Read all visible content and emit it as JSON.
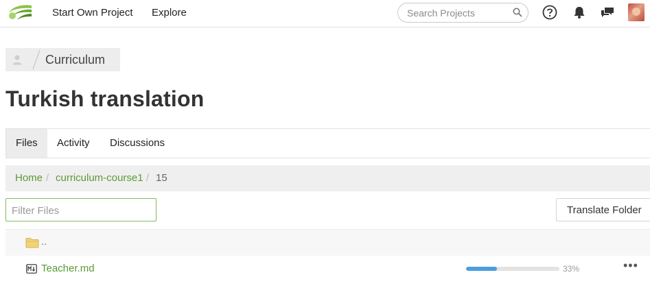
{
  "header": {
    "nav": [
      "Start Own Project",
      "Explore"
    ],
    "search_placeholder": "Search Projects",
    "icons": [
      "search-icon",
      "help-icon",
      "bell-icon",
      "chat-icon"
    ]
  },
  "breadcrumb": {
    "project": "Curriculum"
  },
  "page_title": "Turkish translation",
  "tabs": [
    {
      "label": "Files",
      "active": true
    },
    {
      "label": "Activity",
      "active": false
    },
    {
      "label": "Discussions",
      "active": false
    }
  ],
  "path": {
    "home": "Home",
    "folder": "curriculum-course1",
    "current": "15",
    "separator": "/"
  },
  "filter": {
    "placeholder": "Filter Files",
    "value": ""
  },
  "translate_button": "Translate Folder",
  "parent_row": {
    "label": ".."
  },
  "files": [
    {
      "name": "Teacher.md",
      "progress": 33,
      "progress_label": "33%",
      "menu": "•••"
    }
  ],
  "colors": {
    "accent_green": "#5b9a35",
    "progress_blue": "#4a9ee0"
  }
}
